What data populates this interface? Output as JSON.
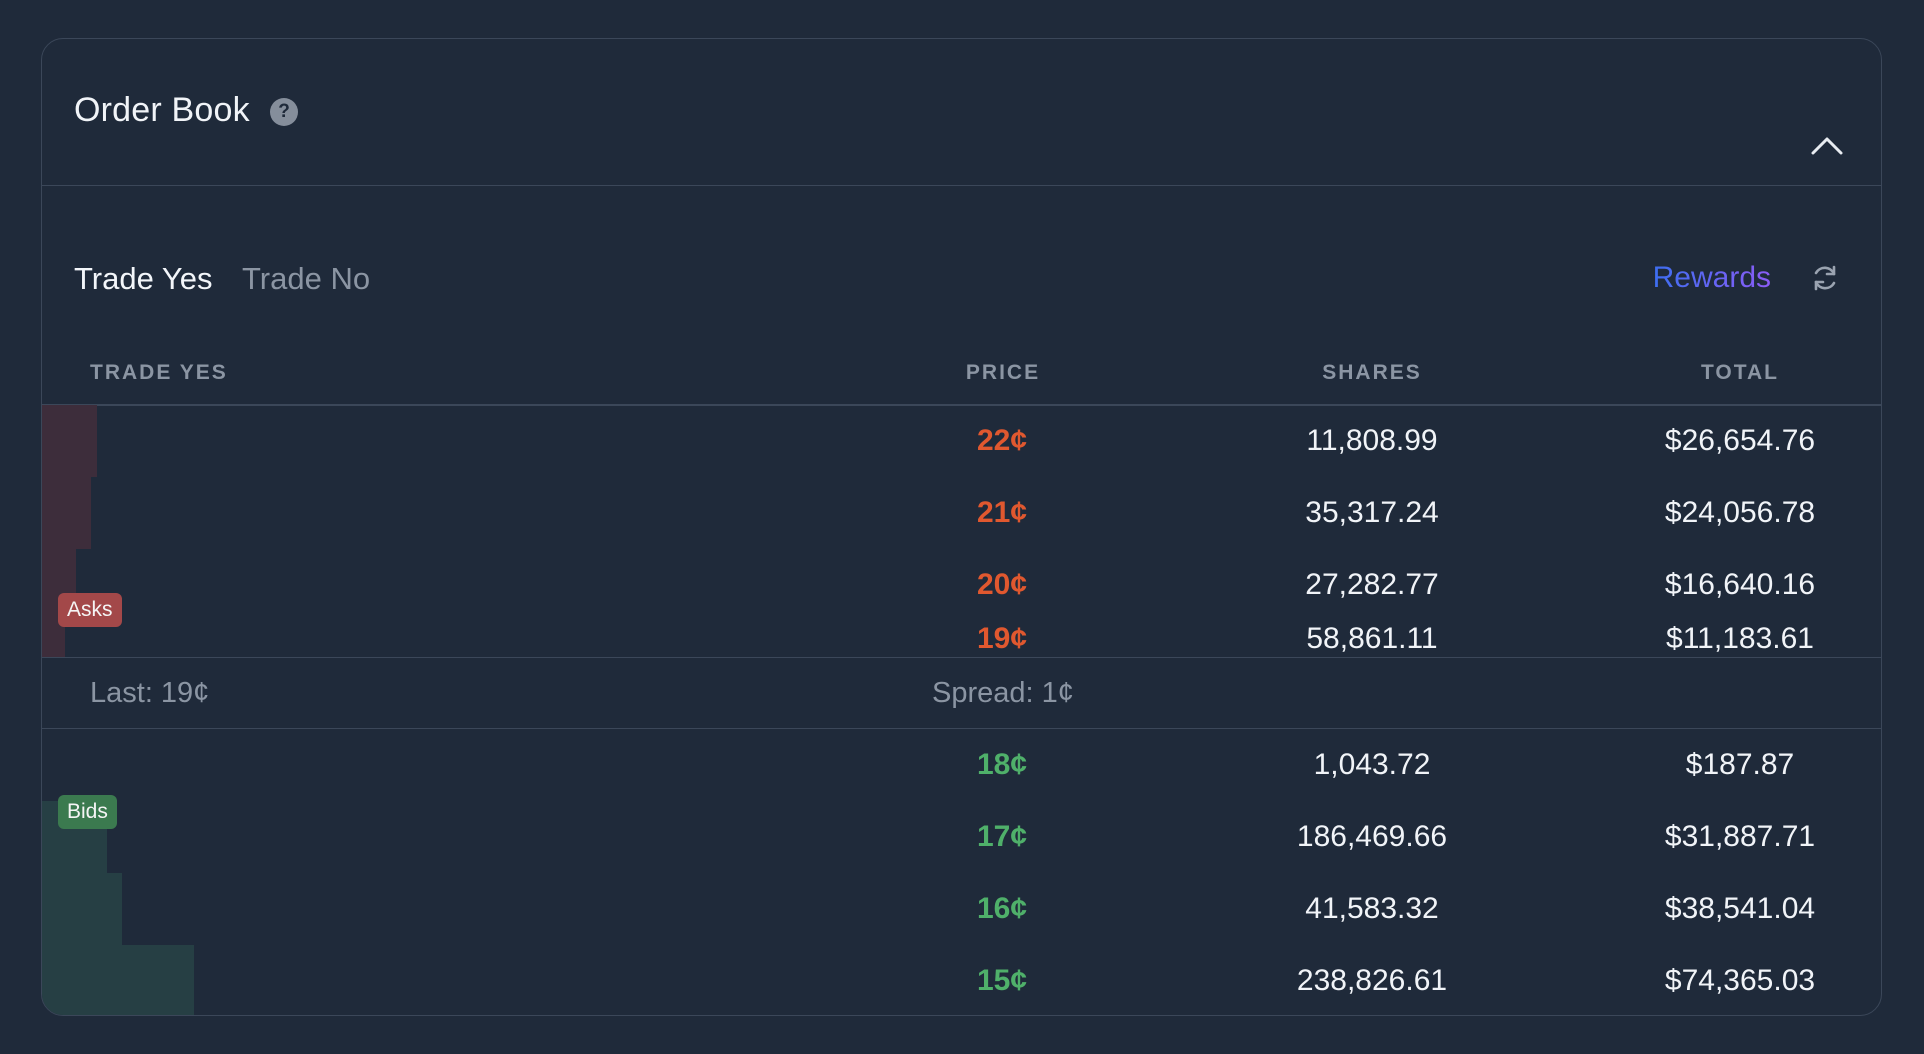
{
  "header": {
    "title": "Order Book",
    "help_icon": "?"
  },
  "tabs": [
    {
      "label": "Trade Yes",
      "active": true
    },
    {
      "label": "Trade No",
      "active": false
    }
  ],
  "rewards_label": "Rewards",
  "columns": {
    "side": "TRADE YES",
    "price": "PRICE",
    "shares": "SHARES",
    "total": "TOTAL"
  },
  "badges": {
    "asks": "Asks",
    "bids": "Bids"
  },
  "asks": [
    {
      "price": "22¢",
      "shares": "11,808.99",
      "total": "$26,654.76",
      "depth": 0.144
    },
    {
      "price": "21¢",
      "shares": "35,317.24",
      "total": "$24,056.78",
      "depth": 0.13
    },
    {
      "price": "20¢",
      "shares": "27,282.77",
      "total": "$16,640.16",
      "depth": 0.09
    },
    {
      "price": "19¢",
      "shares": "58,861.11",
      "total": "$11,183.61",
      "depth": 0.06
    }
  ],
  "summary": {
    "last": "Last: 19¢",
    "spread": "Spread: 1¢"
  },
  "bids": [
    {
      "price": "18¢",
      "shares": "1,043.72",
      "total": "$187.87",
      "depth": 0.0
    },
    {
      "price": "17¢",
      "shares": "186,469.66",
      "total": "$31,887.71",
      "depth": 0.17
    },
    {
      "price": "16¢",
      "shares": "41,583.32",
      "total": "$38,541.04",
      "depth": 0.21
    },
    {
      "price": "15¢",
      "shares": "238,826.61",
      "total": "$74,365.03",
      "depth": 0.4
    }
  ],
  "colors": {
    "ask_price": "#e0582f",
    "bid_price": "#4fb06a",
    "ask_depth": "#3d2d3b",
    "bid_depth": "#263f44",
    "asks_badge": "#a34849",
    "bids_badge": "#3b7a4f"
  },
  "icons": {
    "help": "question-circle-icon",
    "collapse": "chevron-up-icon",
    "refresh": "refresh-icon"
  }
}
